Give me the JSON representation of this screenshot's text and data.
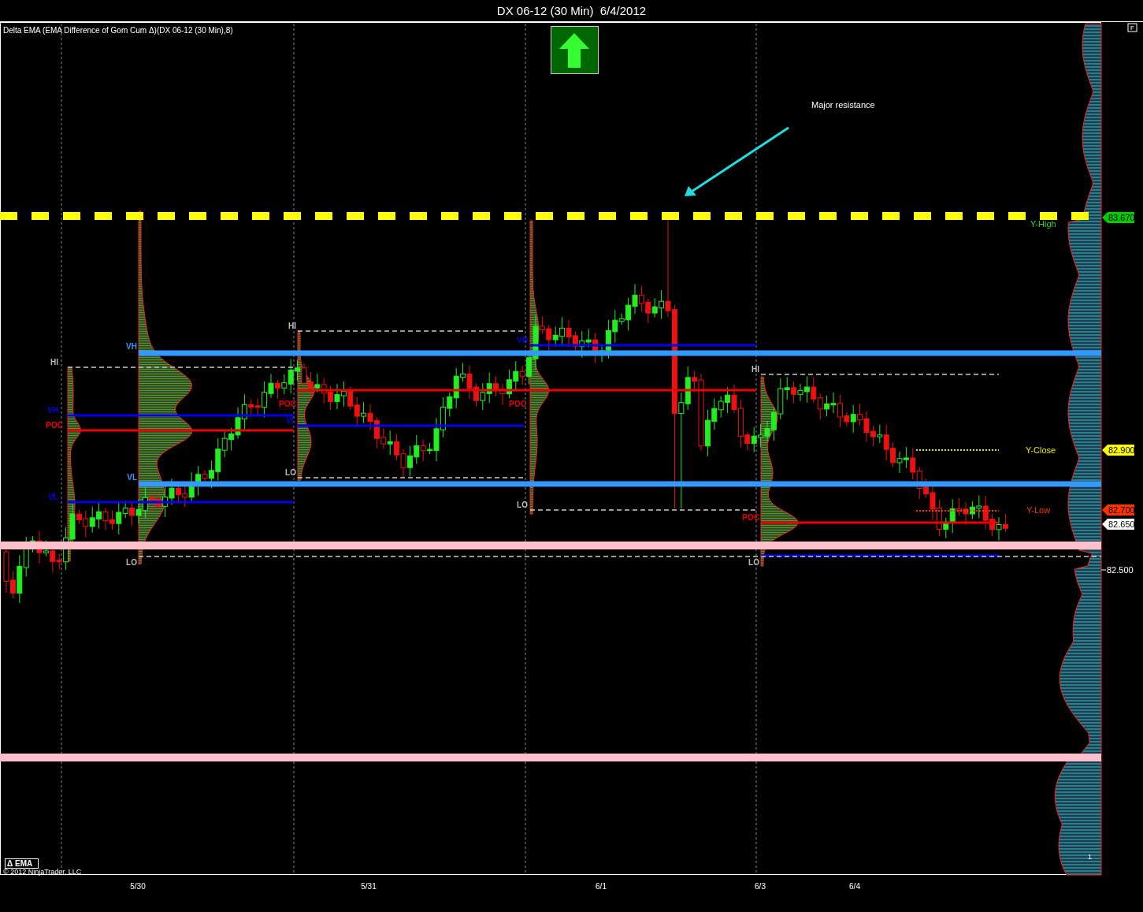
{
  "window": {
    "title": "DX 06-12 (30 Min)  6/4/2012"
  },
  "chart": {
    "indicator_label": "Delta EMA (EMA Difference of Gom Cum Δ)(DX 06-12 (30 Min),8)",
    "panel_button": "F",
    "annotation": "Major resistance",
    "level_labels": [
      {
        "text": "Y-High",
        "color": "#33cc33"
      },
      {
        "text": "Y-Close",
        "color": "#e6e600"
      },
      {
        "text": "Y-Low",
        "color": "#ff3300"
      }
    ],
    "price_tags": [
      {
        "text": "83.670",
        "color": "#00cc00"
      },
      {
        "text": "82.900",
        "color": "#ffff00"
      },
      {
        "text": "82.700",
        "color": "#ff3300"
      },
      {
        "text": "82.650",
        "color": "#ffffff"
      }
    ],
    "axis_ticks": [
      "82.500"
    ],
    "session_markers": [
      {
        "text": "HI",
        "color": "#bbbbbb"
      },
      {
        "text": "VH",
        "color": "#0000ee"
      },
      {
        "text": "POC",
        "color": "#ee0000"
      },
      {
        "text": "VL",
        "color": "#0000ee"
      },
      {
        "text": "VH",
        "color": "#3399ff"
      },
      {
        "text": "VL",
        "color": "#3399ff"
      },
      {
        "text": "LO",
        "color": "#bbbbbb"
      },
      {
        "text": "HI",
        "color": "#bbbbbb"
      },
      {
        "text": "POC",
        "color": "#ee0000"
      },
      {
        "text": "VL",
        "color": "#0000ee"
      },
      {
        "text": "LO",
        "color": "#bbbbbb"
      },
      {
        "text": "VH",
        "color": "#0000ee"
      },
      {
        "text": "POC",
        "color": "#ee0000"
      },
      {
        "text": "LO",
        "color": "#bbbbbb"
      },
      {
        "text": "HI",
        "color": "#bbbbbb"
      },
      {
        "text": "POC",
        "color": "#ee0000"
      },
      {
        "text": "LO",
        "color": "#bbbbbb"
      }
    ],
    "date_labels": [
      "5/30",
      "5/31",
      "6/1",
      "6/3",
      "6/4"
    ],
    "legend": "Δ EMA",
    "copyright": "© 2012 NinjaTrader, LLC",
    "panel_number": "1"
  }
}
